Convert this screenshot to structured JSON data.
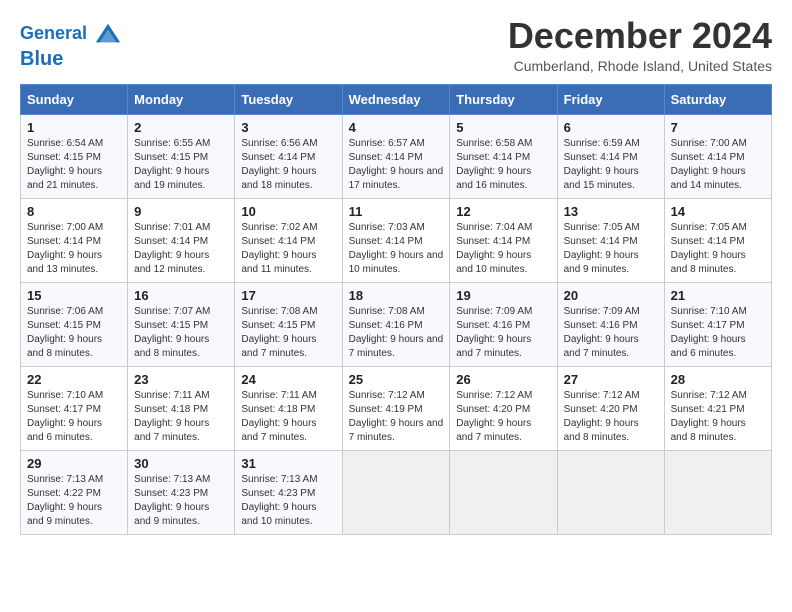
{
  "header": {
    "logo_line1": "General",
    "logo_line2": "Blue",
    "month_title": "December 2024",
    "location": "Cumberland, Rhode Island, United States"
  },
  "weekdays": [
    "Sunday",
    "Monday",
    "Tuesday",
    "Wednesday",
    "Thursday",
    "Friday",
    "Saturday"
  ],
  "weeks": [
    [
      {
        "day": "1",
        "info": "Sunrise: 6:54 AM\nSunset: 4:15 PM\nDaylight: 9 hours and 21 minutes."
      },
      {
        "day": "2",
        "info": "Sunrise: 6:55 AM\nSunset: 4:15 PM\nDaylight: 9 hours and 19 minutes."
      },
      {
        "day": "3",
        "info": "Sunrise: 6:56 AM\nSunset: 4:14 PM\nDaylight: 9 hours and 18 minutes."
      },
      {
        "day": "4",
        "info": "Sunrise: 6:57 AM\nSunset: 4:14 PM\nDaylight: 9 hours and 17 minutes."
      },
      {
        "day": "5",
        "info": "Sunrise: 6:58 AM\nSunset: 4:14 PM\nDaylight: 9 hours and 16 minutes."
      },
      {
        "day": "6",
        "info": "Sunrise: 6:59 AM\nSunset: 4:14 PM\nDaylight: 9 hours and 15 minutes."
      },
      {
        "day": "7",
        "info": "Sunrise: 7:00 AM\nSunset: 4:14 PM\nDaylight: 9 hours and 14 minutes."
      }
    ],
    [
      {
        "day": "8",
        "info": "Sunrise: 7:00 AM\nSunset: 4:14 PM\nDaylight: 9 hours and 13 minutes."
      },
      {
        "day": "9",
        "info": "Sunrise: 7:01 AM\nSunset: 4:14 PM\nDaylight: 9 hours and 12 minutes."
      },
      {
        "day": "10",
        "info": "Sunrise: 7:02 AM\nSunset: 4:14 PM\nDaylight: 9 hours and 11 minutes."
      },
      {
        "day": "11",
        "info": "Sunrise: 7:03 AM\nSunset: 4:14 PM\nDaylight: 9 hours and 10 minutes."
      },
      {
        "day": "12",
        "info": "Sunrise: 7:04 AM\nSunset: 4:14 PM\nDaylight: 9 hours and 10 minutes."
      },
      {
        "day": "13",
        "info": "Sunrise: 7:05 AM\nSunset: 4:14 PM\nDaylight: 9 hours and 9 minutes."
      },
      {
        "day": "14",
        "info": "Sunrise: 7:05 AM\nSunset: 4:14 PM\nDaylight: 9 hours and 8 minutes."
      }
    ],
    [
      {
        "day": "15",
        "info": "Sunrise: 7:06 AM\nSunset: 4:15 PM\nDaylight: 9 hours and 8 minutes."
      },
      {
        "day": "16",
        "info": "Sunrise: 7:07 AM\nSunset: 4:15 PM\nDaylight: 9 hours and 8 minutes."
      },
      {
        "day": "17",
        "info": "Sunrise: 7:08 AM\nSunset: 4:15 PM\nDaylight: 9 hours and 7 minutes."
      },
      {
        "day": "18",
        "info": "Sunrise: 7:08 AM\nSunset: 4:16 PM\nDaylight: 9 hours and 7 minutes."
      },
      {
        "day": "19",
        "info": "Sunrise: 7:09 AM\nSunset: 4:16 PM\nDaylight: 9 hours and 7 minutes."
      },
      {
        "day": "20",
        "info": "Sunrise: 7:09 AM\nSunset: 4:16 PM\nDaylight: 9 hours and 7 minutes."
      },
      {
        "day": "21",
        "info": "Sunrise: 7:10 AM\nSunset: 4:17 PM\nDaylight: 9 hours and 6 minutes."
      }
    ],
    [
      {
        "day": "22",
        "info": "Sunrise: 7:10 AM\nSunset: 4:17 PM\nDaylight: 9 hours and 6 minutes."
      },
      {
        "day": "23",
        "info": "Sunrise: 7:11 AM\nSunset: 4:18 PM\nDaylight: 9 hours and 7 minutes."
      },
      {
        "day": "24",
        "info": "Sunrise: 7:11 AM\nSunset: 4:18 PM\nDaylight: 9 hours and 7 minutes."
      },
      {
        "day": "25",
        "info": "Sunrise: 7:12 AM\nSunset: 4:19 PM\nDaylight: 9 hours and 7 minutes."
      },
      {
        "day": "26",
        "info": "Sunrise: 7:12 AM\nSunset: 4:20 PM\nDaylight: 9 hours and 7 minutes."
      },
      {
        "day": "27",
        "info": "Sunrise: 7:12 AM\nSunset: 4:20 PM\nDaylight: 9 hours and 8 minutes."
      },
      {
        "day": "28",
        "info": "Sunrise: 7:12 AM\nSunset: 4:21 PM\nDaylight: 9 hours and 8 minutes."
      }
    ],
    [
      {
        "day": "29",
        "info": "Sunrise: 7:13 AM\nSunset: 4:22 PM\nDaylight: 9 hours and 9 minutes."
      },
      {
        "day": "30",
        "info": "Sunrise: 7:13 AM\nSunset: 4:23 PM\nDaylight: 9 hours and 9 minutes."
      },
      {
        "day": "31",
        "info": "Sunrise: 7:13 AM\nSunset: 4:23 PM\nDaylight: 9 hours and 10 minutes."
      },
      null,
      null,
      null,
      null
    ]
  ]
}
